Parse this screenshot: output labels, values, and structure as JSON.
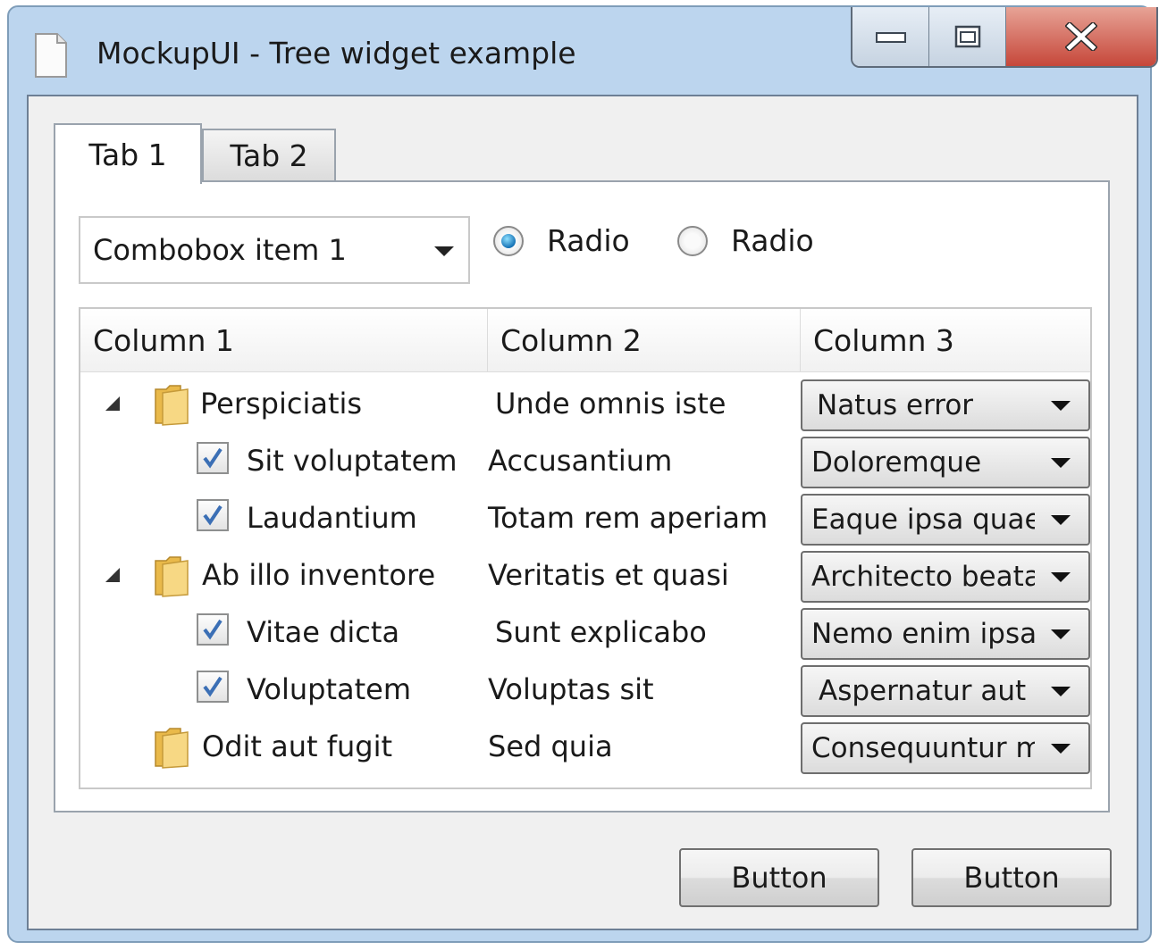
{
  "window": {
    "title": "MockupUI - Tree widget example"
  },
  "tabs": [
    {
      "label": "Tab 1",
      "active": true
    },
    {
      "label": "Tab 2",
      "active": false
    }
  ],
  "combobox": {
    "value": "Combobox item 1"
  },
  "radios": [
    {
      "label": "Radio",
      "checked": true
    },
    {
      "label": "Radio",
      "checked": false
    }
  ],
  "tree": {
    "columns": [
      "Column 1",
      "Column 2",
      "Column 3"
    ],
    "rows": [
      {
        "type": "folder",
        "expanded": true,
        "col1": "Perspiciatis",
        "col2": "Unde omnis iste",
        "col3": "Natus error"
      },
      {
        "type": "check",
        "checked": true,
        "col1": "Sit voluptatem",
        "col2": "Accusantium",
        "col3": "Doloremque"
      },
      {
        "type": "check",
        "checked": true,
        "col1": "Laudantium",
        "col2": "Totam rem aperiam",
        "col3": "Eaque ipsa quae"
      },
      {
        "type": "folder",
        "expanded": true,
        "col1": "Ab illo inventore",
        "col2": "Veritatis et quasi",
        "col3": "Architecto beatae"
      },
      {
        "type": "check",
        "checked": true,
        "col1": "Vitae dicta",
        "col2": "Sunt explicabo",
        "col3": "Nemo enim ipsam"
      },
      {
        "type": "check",
        "checked": true,
        "col1": "Voluptatem",
        "col2": "Voluptas sit",
        "col3": "Aspernatur aut"
      },
      {
        "type": "folder",
        "expanded": false,
        "col1": "Odit aut fugit",
        "col2": "Sed quia",
        "col3": "Consequuntur magni"
      }
    ]
  },
  "buttons": [
    {
      "label": "Button"
    },
    {
      "label": "Button"
    }
  ],
  "colors": {
    "window_frame": "#bcd5ee",
    "close_button": "#c6473a",
    "radio_selected": "#1673b6",
    "checkmark": "#3b6fb5",
    "folder": "#f2cf6b"
  }
}
